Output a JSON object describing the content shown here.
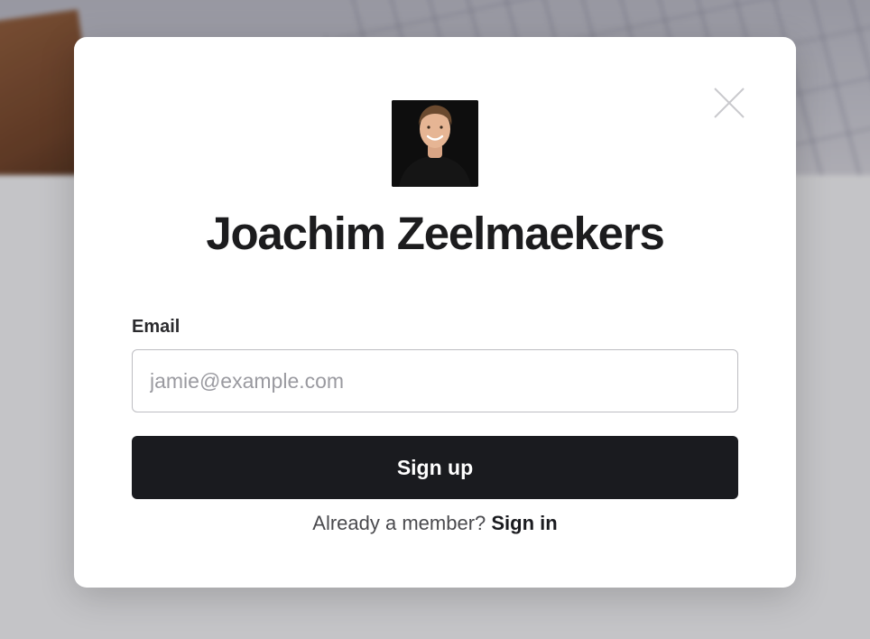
{
  "modal": {
    "title": "Joachim Zeelmaekers",
    "email_label": "Email",
    "email_placeholder": "jamie@example.com",
    "email_value": "",
    "signup_label": "Sign up",
    "member_prompt": "Already a member?",
    "signin_label": "Sign in"
  },
  "icons": {
    "close": "close-icon",
    "avatar": "profile-photo"
  },
  "colors": {
    "button_bg": "#1a1b1f",
    "button_text": "#ffffff",
    "modal_bg": "#ffffff",
    "input_border": "#bdbdc2"
  }
}
